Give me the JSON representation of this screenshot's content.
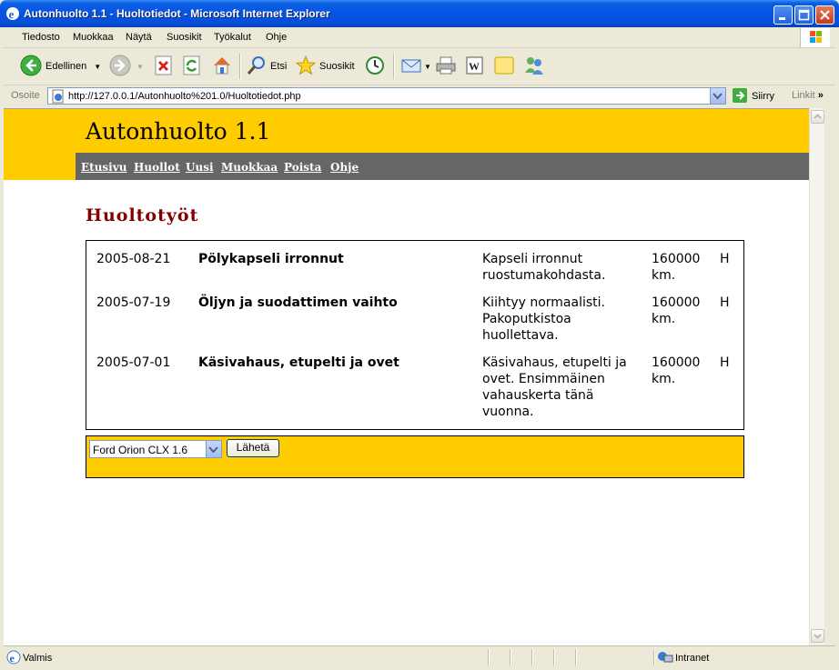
{
  "window": {
    "title": "Autonhuolto 1.1 - Huoltotiedot - Microsoft Internet Explorer"
  },
  "menu": {
    "items": [
      "Tiedosto",
      "Muokkaa",
      "Näytä",
      "Suosikit",
      "Työkalut",
      "Ohje"
    ]
  },
  "toolbar": {
    "back_label": "Edellinen",
    "search_label": "Etsi",
    "favorites_label": "Suosikit"
  },
  "address": {
    "label": "Osoite",
    "url": "http://127.0.0.1/Autonhuolto%201.0/Huoltotiedot.php",
    "go_label": "Siirry",
    "links_label": "Linkit"
  },
  "page": {
    "site_title": "Autonhuolto 1.1",
    "nav": [
      "Etusivu",
      "Huollot",
      "Uusi",
      "Muokkaa",
      "Poista",
      "Ohje"
    ],
    "heading": "Huoltotyöt",
    "entries": [
      {
        "date": "2005-08-21",
        "title": "Pölykapseli irronnut",
        "description": "Kapseli irronnut ruostumakohdasta.",
        "mileage": "160000 km.",
        "flag": "H"
      },
      {
        "date": "2005-07-19",
        "title": "Öljyn ja suodattimen vaihto",
        "description": "Kiihtyy normaalisti. Pakoputkistoa huollettava.",
        "mileage": "160000 km.",
        "flag": "H"
      },
      {
        "date": "2005-07-01",
        "title": "Käsivahaus, etupelti ja ovet",
        "description": "Käsivahaus, etupelti ja ovet. Ensimmäinen vahauskerta tänä vuonna.",
        "mileage": "160000 km.",
        "flag": "H"
      }
    ],
    "form": {
      "selected_car": "Ford Orion CLX 1.6",
      "submit_label": "Lähetä"
    }
  },
  "status": {
    "text": "Valmis",
    "zone": "Intranet"
  },
  "colors": {
    "header_yellow": "#FFCC00",
    "nav_gray": "#666666",
    "heading_red": "#800000"
  }
}
